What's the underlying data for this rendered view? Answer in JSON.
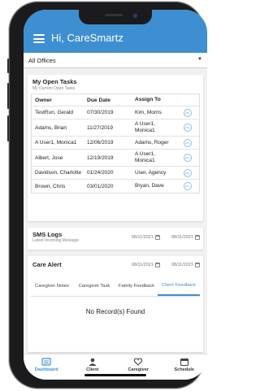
{
  "header": {
    "title": "Hi, CareSmartz"
  },
  "office_selector": {
    "value": "All Offices"
  },
  "open_tasks": {
    "title": "My Open Tasks",
    "subtitle": "My Current Open Tasks",
    "columns": [
      "Owner",
      "Due Date",
      "Assign To"
    ],
    "rows": [
      {
        "owner": "TestRun, Gerald",
        "due": "07/30/2019",
        "assign": "Kim, Morris"
      },
      {
        "owner": "Adams, Brian",
        "due": "11/27/2019",
        "assign": "A User1, Monica1"
      },
      {
        "owner": "A User1, Monica1",
        "due": "12/06/2019",
        "assign": "Adams, Roger"
      },
      {
        "owner": "Albert, Jose",
        "due": "12/19/2019",
        "assign": "A User1, Monica1"
      },
      {
        "owner": "Davidson, Charlotte",
        "due": "01/24/2020",
        "assign": "User, Agency"
      },
      {
        "owner": "Brown, Chris",
        "due": "03/01/2020",
        "assign": "Bryan, Dave"
      }
    ]
  },
  "sms_logs": {
    "title": "SMS Logs",
    "subtitle": "Latest Incoming Message",
    "date_from": "08/11/2021",
    "date_to": "08/11/2021"
  },
  "care_alert": {
    "title": "Care Alert",
    "date_from": "08/11/2021",
    "date_to": "08/11/2021",
    "tabs": [
      "Caregiver Notes",
      "Caregiver Task",
      "Family Feedback",
      "Client Feedback"
    ],
    "empty_message": "No Record(s) Found"
  },
  "bottom_nav": [
    "Dashboard",
    "Client",
    "Caregiver",
    "Schedule"
  ],
  "colors": {
    "accent": "#3e8fd1"
  }
}
